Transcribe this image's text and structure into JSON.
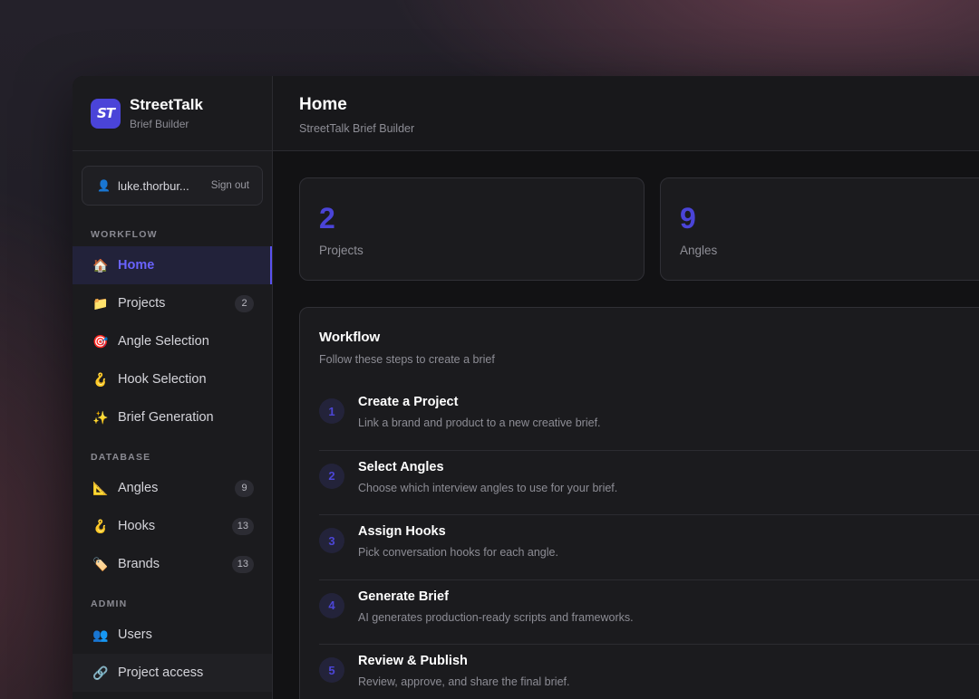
{
  "brand": {
    "name": "StreetTalk",
    "subtitle": "Brief Builder",
    "logo_text": "ST",
    "accent": "#4a44d8"
  },
  "user": {
    "name": "luke.thorbur...",
    "icon": "user-icon",
    "signout_label": "Sign out"
  },
  "sidebar": {
    "workflow_label": "WORKFLOW",
    "workflow_items": [
      {
        "label": "Home",
        "icon": "house-icon",
        "active": true
      },
      {
        "label": "Projects",
        "icon": "folder-icon",
        "badge": "2"
      },
      {
        "label": "Angle Selection",
        "icon": "target-icon"
      },
      {
        "label": "Hook Selection",
        "icon": "hook-icon"
      },
      {
        "label": "Brief Generation",
        "icon": "sparkles-icon"
      }
    ],
    "database_label": "DATABASE",
    "database_items": [
      {
        "label": "Angles",
        "icon": "triangle-ruler-icon",
        "badge": "9"
      },
      {
        "label": "Hooks",
        "icon": "hook-icon",
        "badge": "13"
      },
      {
        "label": "Brands",
        "icon": "label-tag-icon",
        "badge": "13"
      }
    ],
    "admin_label": "ADMIN",
    "admin_items": [
      {
        "label": "Users",
        "icon": "users-icon"
      },
      {
        "label": "Project access",
        "icon": "link-icon"
      }
    ]
  },
  "header": {
    "title": "Home",
    "subtitle": "StreetTalk Brief Builder"
  },
  "stats": [
    {
      "value": "2",
      "label": "Projects"
    },
    {
      "value": "9",
      "label": "Angles"
    }
  ],
  "workflow": {
    "title": "Workflow",
    "subtitle": "Follow these steps to create a brief",
    "steps": [
      {
        "num": "1",
        "title": "Create a Project",
        "desc": "Link a brand and product to a new creative brief."
      },
      {
        "num": "2",
        "title": "Select Angles",
        "desc": "Choose which interview angles to use for your brief."
      },
      {
        "num": "3",
        "title": "Assign Hooks",
        "desc": "Pick conversation hooks for each angle."
      },
      {
        "num": "4",
        "title": "Generate Brief",
        "desc": "AI generates production-ready scripts and frameworks."
      },
      {
        "num": "5",
        "title": "Review & Publish",
        "desc": "Review, approve, and share the final brief."
      }
    ]
  }
}
